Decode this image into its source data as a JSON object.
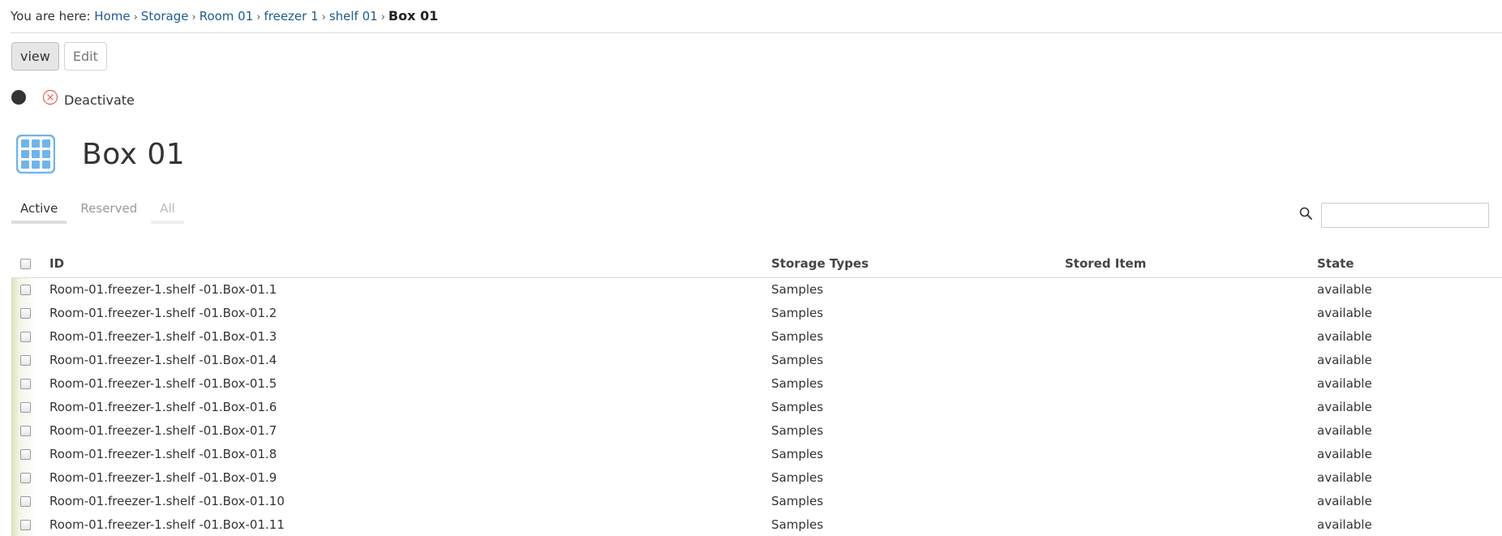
{
  "breadcrumb": {
    "prefix": "You are here:",
    "links": [
      "Home",
      "Storage",
      "Room 01",
      "freezer 1",
      "shelf 01"
    ],
    "current": "Box 01",
    "separator": "›"
  },
  "view_tabs": [
    {
      "label": "view",
      "selected": true
    },
    {
      "label": "Edit",
      "selected": false
    }
  ],
  "status": {
    "deactivate_label": "Deactivate",
    "deactivate_color": "#e06060"
  },
  "page": {
    "title": "Box 01",
    "icon": "grid-icon",
    "icon_color": "#6fb4ea"
  },
  "filter_tabs": [
    {
      "label": "Active",
      "selected": true
    },
    {
      "label": "Reserved",
      "selected": false
    },
    {
      "label": "All",
      "selected": false
    }
  ],
  "search": {
    "placeholder": "",
    "value": ""
  },
  "table": {
    "columns": [
      "ID",
      "Storage Types",
      "Stored Item",
      "State"
    ],
    "rows": [
      {
        "id": "Room-01.freezer-1.shelf -01.Box-01.1",
        "type": "Samples",
        "stored": "",
        "state": "available"
      },
      {
        "id": "Room-01.freezer-1.shelf -01.Box-01.2",
        "type": "Samples",
        "stored": "",
        "state": "available"
      },
      {
        "id": "Room-01.freezer-1.shelf -01.Box-01.3",
        "type": "Samples",
        "stored": "",
        "state": "available"
      },
      {
        "id": "Room-01.freezer-1.shelf -01.Box-01.4",
        "type": "Samples",
        "stored": "",
        "state": "available"
      },
      {
        "id": "Room-01.freezer-1.shelf -01.Box-01.5",
        "type": "Samples",
        "stored": "",
        "state": "available"
      },
      {
        "id": "Room-01.freezer-1.shelf -01.Box-01.6",
        "type": "Samples",
        "stored": "",
        "state": "available"
      },
      {
        "id": "Room-01.freezer-1.shelf -01.Box-01.7",
        "type": "Samples",
        "stored": "",
        "state": "available"
      },
      {
        "id": "Room-01.freezer-1.shelf -01.Box-01.8",
        "type": "Samples",
        "stored": "",
        "state": "available"
      },
      {
        "id": "Room-01.freezer-1.shelf -01.Box-01.9",
        "type": "Samples",
        "stored": "",
        "state": "available"
      },
      {
        "id": "Room-01.freezer-1.shelf -01.Box-01.10",
        "type": "Samples",
        "stored": "",
        "state": "available"
      },
      {
        "id": "Room-01.freezer-1.shelf -01.Box-01.11",
        "type": "Samples",
        "stored": "",
        "state": "available"
      }
    ]
  }
}
